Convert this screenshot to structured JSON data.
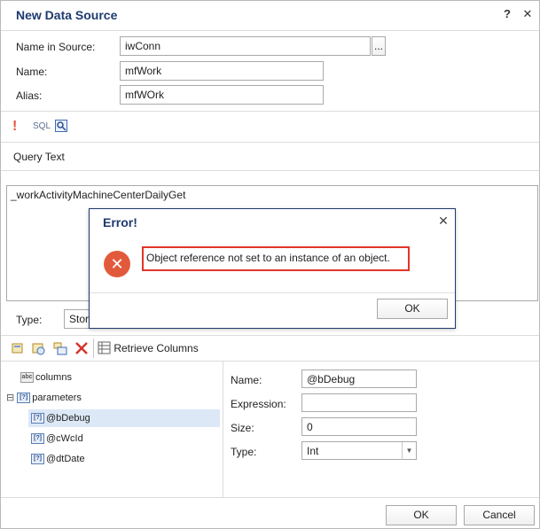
{
  "dialog": {
    "title": "New Data Source",
    "help_label": "?",
    "close_label": "✕"
  },
  "form": {
    "name_in_source_label": "Name in Source:",
    "name_in_source_value": "iwConn",
    "browse_label": "...",
    "name_label": "Name:",
    "name_value": "mfWork",
    "alias_label": "Alias:",
    "alias_value": "mfWOrk"
  },
  "toolbar": {
    "exclaim_label": "!",
    "sql_label": "SQL"
  },
  "query": {
    "label": "Query Text",
    "text": "_workActivityMachineCenterDailyGet"
  },
  "type": {
    "label": "Type:",
    "value": "Stor"
  },
  "columns_toolbar": {
    "retrieve_label": "Retrieve Columns"
  },
  "tree": {
    "columns_label": "columns",
    "columns_badge": "abc",
    "parameters_label": "parameters",
    "expander": "⊟",
    "param_badge": "[?]",
    "items": [
      {
        "label": "@bDebug"
      },
      {
        "label": "@cWcId"
      },
      {
        "label": "@dtDate"
      }
    ]
  },
  "props": {
    "name_label": "Name:",
    "name_value": "@bDebug",
    "expression_label": "Expression:",
    "expression_value": "",
    "size_label": "Size:",
    "size_value": "0",
    "type_label": "Type:",
    "type_value": "Int",
    "type_arrow": "▼"
  },
  "footer": {
    "ok_label": "OK",
    "cancel_label": "Cancel"
  },
  "error": {
    "title": "Error!",
    "close_label": "✕",
    "icon_glyph": "✕",
    "message": "Object reference not set to an instance of an object.",
    "ok_label": "OK"
  }
}
